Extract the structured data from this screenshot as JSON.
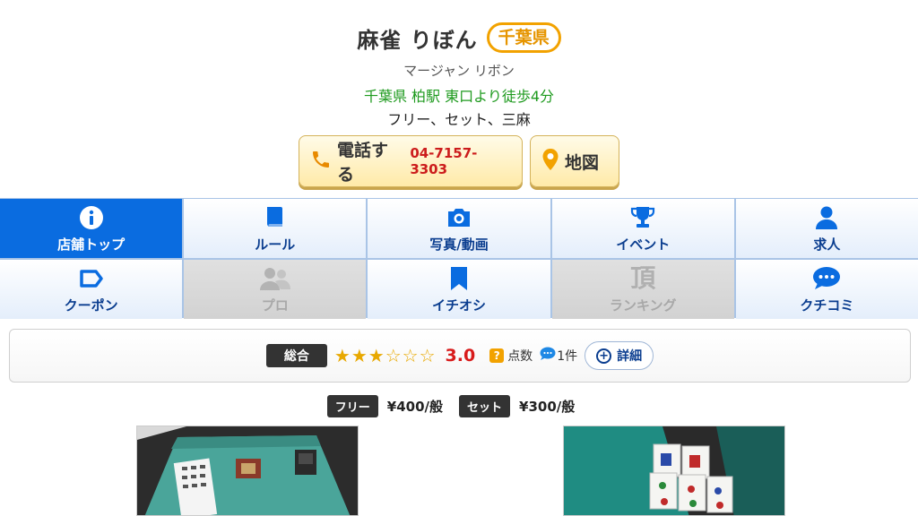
{
  "header": {
    "shop_name": "麻雀 りぼん",
    "prefecture_badge": "千葉県",
    "kana": "マージャン リボン",
    "access": "千葉県 柏駅 東口より徒歩4分",
    "game_types": "フリー、セット、三麻"
  },
  "actions": {
    "call_label": "電話する",
    "phone_number": "04-7157-3303",
    "map_label": "地図"
  },
  "nav": {
    "items": [
      {
        "label": "店舗トップ",
        "icon": "info-icon",
        "state": "active"
      },
      {
        "label": "ルール",
        "icon": "book-icon",
        "state": "normal"
      },
      {
        "label": "写真/動画",
        "icon": "camera-icon",
        "state": "normal"
      },
      {
        "label": "イベント",
        "icon": "trophy-icon",
        "state": "normal"
      },
      {
        "label": "求人",
        "icon": "person-icon",
        "state": "normal"
      },
      {
        "label": "クーポン",
        "icon": "coupon-icon",
        "state": "normal"
      },
      {
        "label": "プロ",
        "icon": "people-icon",
        "state": "disabled"
      },
      {
        "label": "イチオシ",
        "icon": "bookmark-icon",
        "state": "normal"
      },
      {
        "label": "ランキング",
        "icon": "ranking-icon",
        "state": "disabled"
      },
      {
        "label": "クチコミ",
        "icon": "comment-icon",
        "state": "normal"
      }
    ]
  },
  "rating": {
    "tag": "総合",
    "stars_filled": 3,
    "stars_total": 6,
    "score": "3.0",
    "points_label": "点数",
    "review_count": "1件",
    "detail_label": "詳細"
  },
  "prices": {
    "free_tag": "フリー",
    "free_price": "¥400/般",
    "set_tag": "セット",
    "set_price": "¥300/般"
  },
  "colors": {
    "accent_blue": "#0a6ce0",
    "nav_text": "#0a3d8f",
    "access_green": "#1e9a1e",
    "phone_red": "#cc1c1c",
    "badge_orange": "#f2a200"
  }
}
